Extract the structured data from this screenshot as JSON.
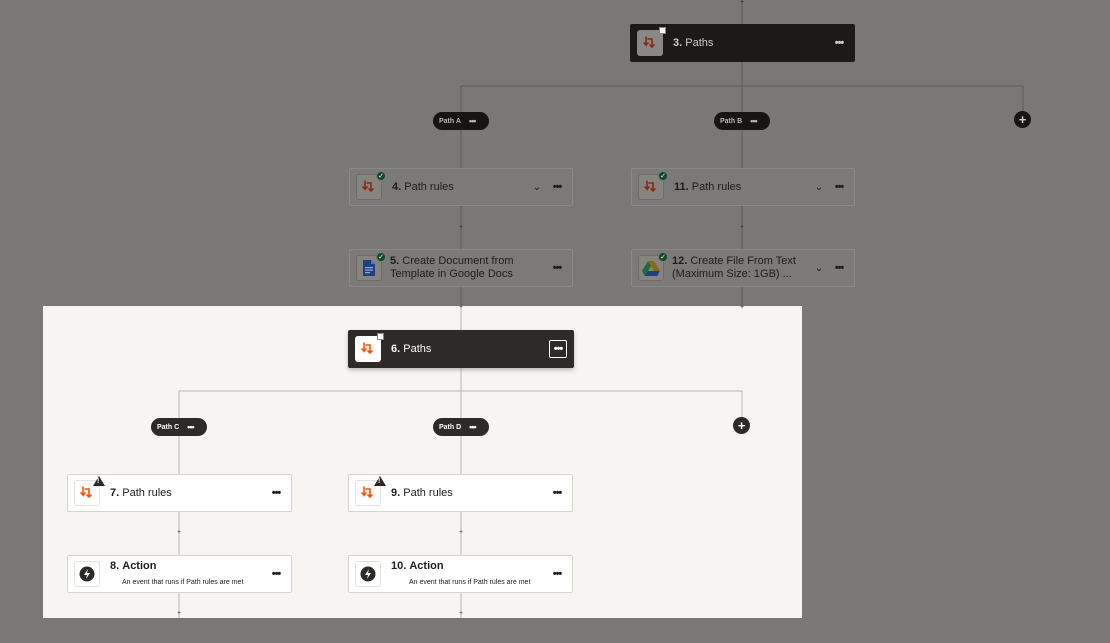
{
  "top": {
    "paths3": {
      "number": "3.",
      "label": "Paths"
    },
    "pathA": {
      "label": "Path A"
    },
    "pathB": {
      "label": "Path B"
    },
    "step4": {
      "number": "4.",
      "label": "Path rules"
    },
    "step5": {
      "number": "5.",
      "label": "Create Document from Template in Google Docs"
    },
    "step11": {
      "number": "11.",
      "label": "Path rules"
    },
    "step12": {
      "number": "12.",
      "label": "Create File From Text (Maximum Size: 1GB) ..."
    }
  },
  "focus": {
    "paths6": {
      "number": "6.",
      "label": "Paths"
    },
    "pathC": {
      "label": "Path C"
    },
    "pathD": {
      "label": "Path D"
    },
    "step7": {
      "number": "7.",
      "label": "Path rules"
    },
    "step8": {
      "number": "8.",
      "label": "Action",
      "desc": "An event that runs if Path rules are met"
    },
    "step9": {
      "number": "9.",
      "label": "Path rules"
    },
    "step10": {
      "number": "10.",
      "label": "Action",
      "desc": "An event that runs if Path rules are met"
    }
  },
  "glyphs": {
    "more": "•••",
    "add": "+",
    "chevron": "⌄",
    "check": "✓",
    "small_plus": "+"
  },
  "colors": {
    "zapier_orange": "#ff4f00",
    "success_green": "#1a7a45",
    "dark_node": "#2d2b29",
    "canvas_dim": "#7a7876"
  },
  "icons": {
    "paths": "paths-icon",
    "google_docs": "google-docs-icon",
    "google_drive": "google-drive-icon",
    "action": "lightning-icon"
  }
}
